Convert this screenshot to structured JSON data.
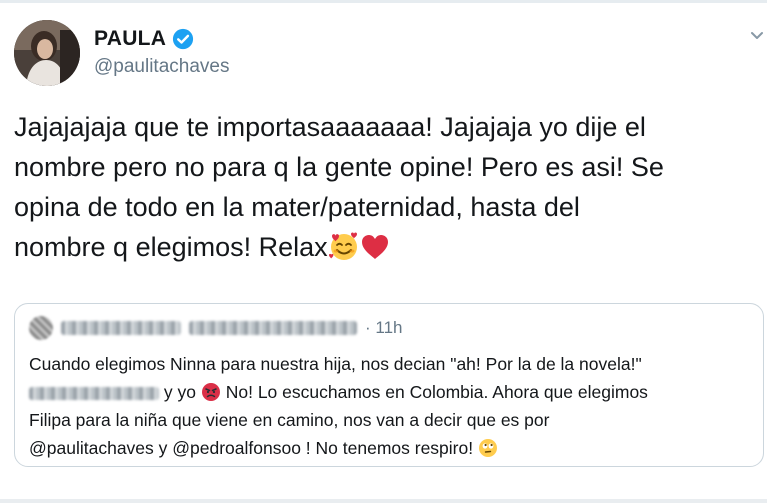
{
  "author": {
    "display_name": "PAULA",
    "handle": "@paulitachaves",
    "verified": true,
    "avatar": "profile-photo"
  },
  "tweet": {
    "lines": [
      "Jajajajaja que te importasaaaaaaa! Jajajaja yo dije el",
      "nombre pero no para q la gente opine! Pero es asi! Se",
      "opina de todo en la mater/paternidad, hasta del",
      "nombre q elegimos! Relax"
    ],
    "emojis": [
      "smiling-face-with-hearts-emoji",
      "red-heart-emoji"
    ]
  },
  "quoted_tweet": {
    "time": "11h",
    "line1": "Cuando elegimos Ninna para nuestra hija, nos decian \"ah! Por la de la novela!\"",
    "line2_mid": "y yo",
    "line2_end": "No! Lo escuchamos en Colombia. Ahora que elegimos",
    "line3": "Filipa para la niña que viene en camino, nos van a decir que es por",
    "line4": "@paulitachaves y @pedroalfonsoo ! No tenemos respiro!",
    "emojis": [
      "angry-face-emoji",
      "face-with-rolling-eyes-emoji"
    ]
  },
  "colors": {
    "verified_blue": "#1da1f2",
    "secondary_text": "#657786",
    "border": "#ccd6dd",
    "heart_red": "#dd2e44",
    "emoji_yellow": "#ffcc4d"
  }
}
